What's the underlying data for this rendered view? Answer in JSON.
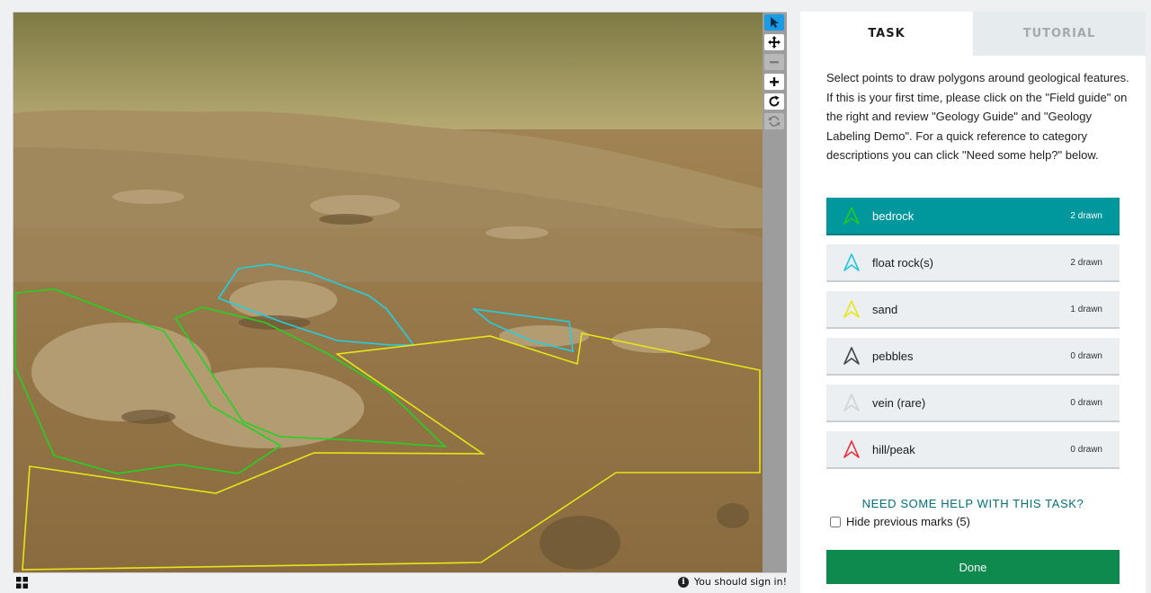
{
  "viewer": {
    "tools": [
      "pointer-tool",
      "pan-tool",
      "zoom-out-tool",
      "zoom-in-tool",
      "rotate-tool",
      "reset-tool"
    ],
    "signin_text": "You should sign in!"
  },
  "tabs": [
    {
      "label": "TASK",
      "active": true
    },
    {
      "label": "TUTORIAL",
      "active": false
    }
  ],
  "task": {
    "instructions": "Select points to draw polygons around geological features. If this is your first time, please click on the \"Field guide\" on the right and review \"Geology Guide\" and \"Geology Labeling Demo\". For a quick reference to category descriptions you can click \"Need some help?\" below.",
    "choices": [
      {
        "label": "bedrock",
        "count": "2 drawn",
        "color": "#22c922",
        "selected": true
      },
      {
        "label": "float rock(s)",
        "count": "2 drawn",
        "color": "#22c6e0",
        "selected": false
      },
      {
        "label": "sand",
        "count": "1 drawn",
        "color": "#e6e61a",
        "selected": false
      },
      {
        "label": "pebbles",
        "count": "0 drawn",
        "color": "#444444",
        "selected": false
      },
      {
        "label": "vein (rare)",
        "count": "0 drawn",
        "color": "#d0d4d6",
        "selected": false
      },
      {
        "label": "hill/peak",
        "count": "0 drawn",
        "color": "#e8323c",
        "selected": false
      }
    ],
    "help_link": "NEED SOME HELP WITH THIS TASK?",
    "hide_marks_label": "Hide previous marks (5)",
    "done_label": "Done"
  },
  "colors": {
    "selected_choice": "#00979d",
    "done_button": "#0f8a4e",
    "active_tool": "#1a9be6"
  }
}
